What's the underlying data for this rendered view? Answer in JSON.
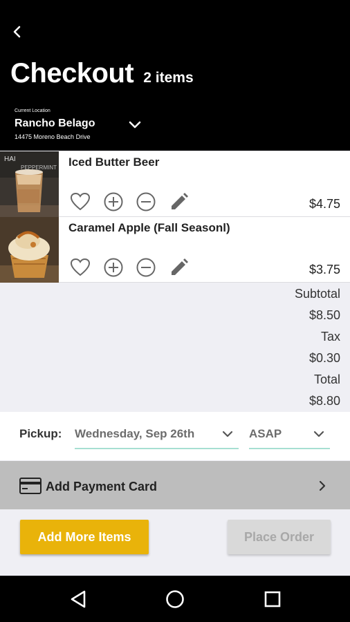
{
  "header": {
    "title": "Checkout",
    "item_count": "2 items",
    "location_caption": "Current Location",
    "location_name": "Rancho Belago",
    "location_address": "14475 Moreno Beach Drive"
  },
  "items": [
    {
      "name": "Iced Butter Beer",
      "price": "$4.75",
      "image": "iced-coffee-photo"
    },
    {
      "name": "Caramel Apple (Fall Seasonl)",
      "price": "$3.75",
      "image": "caramel-apple-cupcake-photo"
    }
  ],
  "totals": {
    "subtotal_label": "Subtotal",
    "subtotal_value": "$8.50",
    "tax_label": "Tax",
    "tax_value": "$0.30",
    "total_label": "Total",
    "total_value": "$8.80"
  },
  "pickup": {
    "label": "Pickup:",
    "date": "Wednesday, Sep 26th",
    "time": "ASAP"
  },
  "payment": {
    "label": "Add Payment Card"
  },
  "buttons": {
    "add_more": "Add More Items",
    "place_order": "Place Order"
  },
  "icons": {
    "back": "back-arrow-icon",
    "location_dropdown": "chevron-down-icon",
    "favorite": "heart-outline-icon",
    "increase": "plus-circle-icon",
    "decrease": "minus-circle-icon",
    "edit": "pencil-icon",
    "card": "credit-card-icon",
    "payment_chevron": "chevron-right-icon",
    "nav": [
      "back-triangle-icon",
      "home-circle-icon",
      "recents-square-icon"
    ]
  },
  "colors": {
    "header_bg": "#000000",
    "accent_yellow": "#e9b30a",
    "underline_teal": "#a6dfd2",
    "payment_bar": "#bdbdbd",
    "disabled_button": "#d9d9d9"
  }
}
